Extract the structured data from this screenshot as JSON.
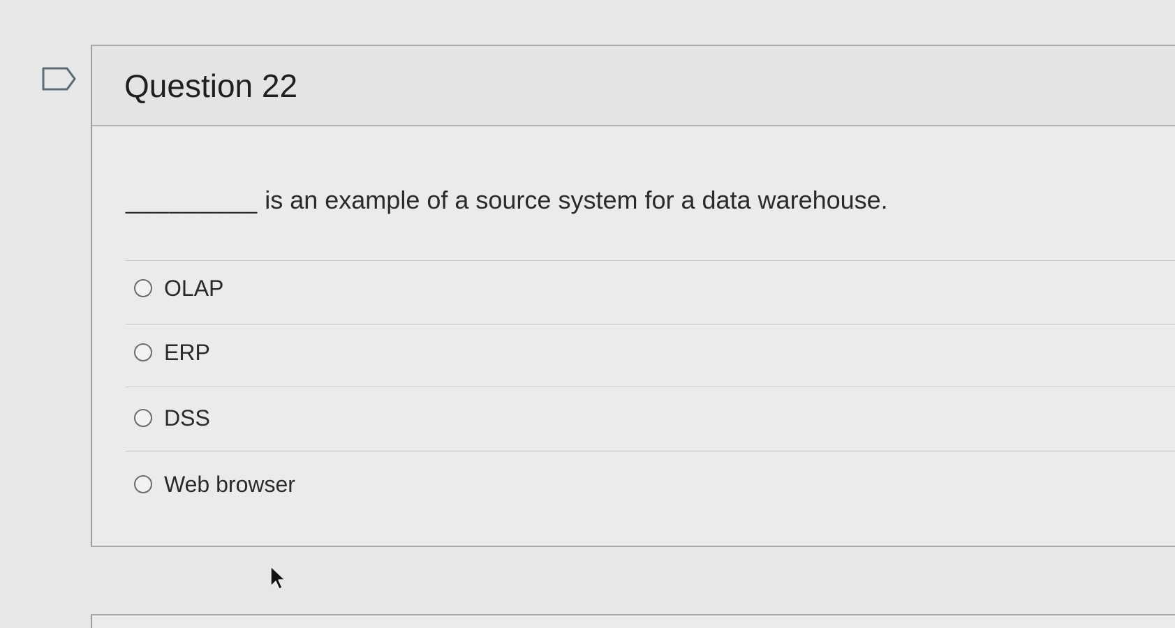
{
  "question": {
    "title": "Question 22",
    "blank": "_________",
    "text": "is an example of a source system for a data warehouse.",
    "options": [
      {
        "label": "OLAP"
      },
      {
        "label": "ERP"
      },
      {
        "label": "DSS"
      },
      {
        "label": "Web browser"
      }
    ]
  },
  "icons": {
    "flag": "flag-outline-icon",
    "cursor": "mouse-pointer-icon"
  },
  "colors": {
    "background": "#e6e7e6",
    "card": "#eaebea",
    "border": "#a8aaa9",
    "text": "#2a2a2a"
  }
}
